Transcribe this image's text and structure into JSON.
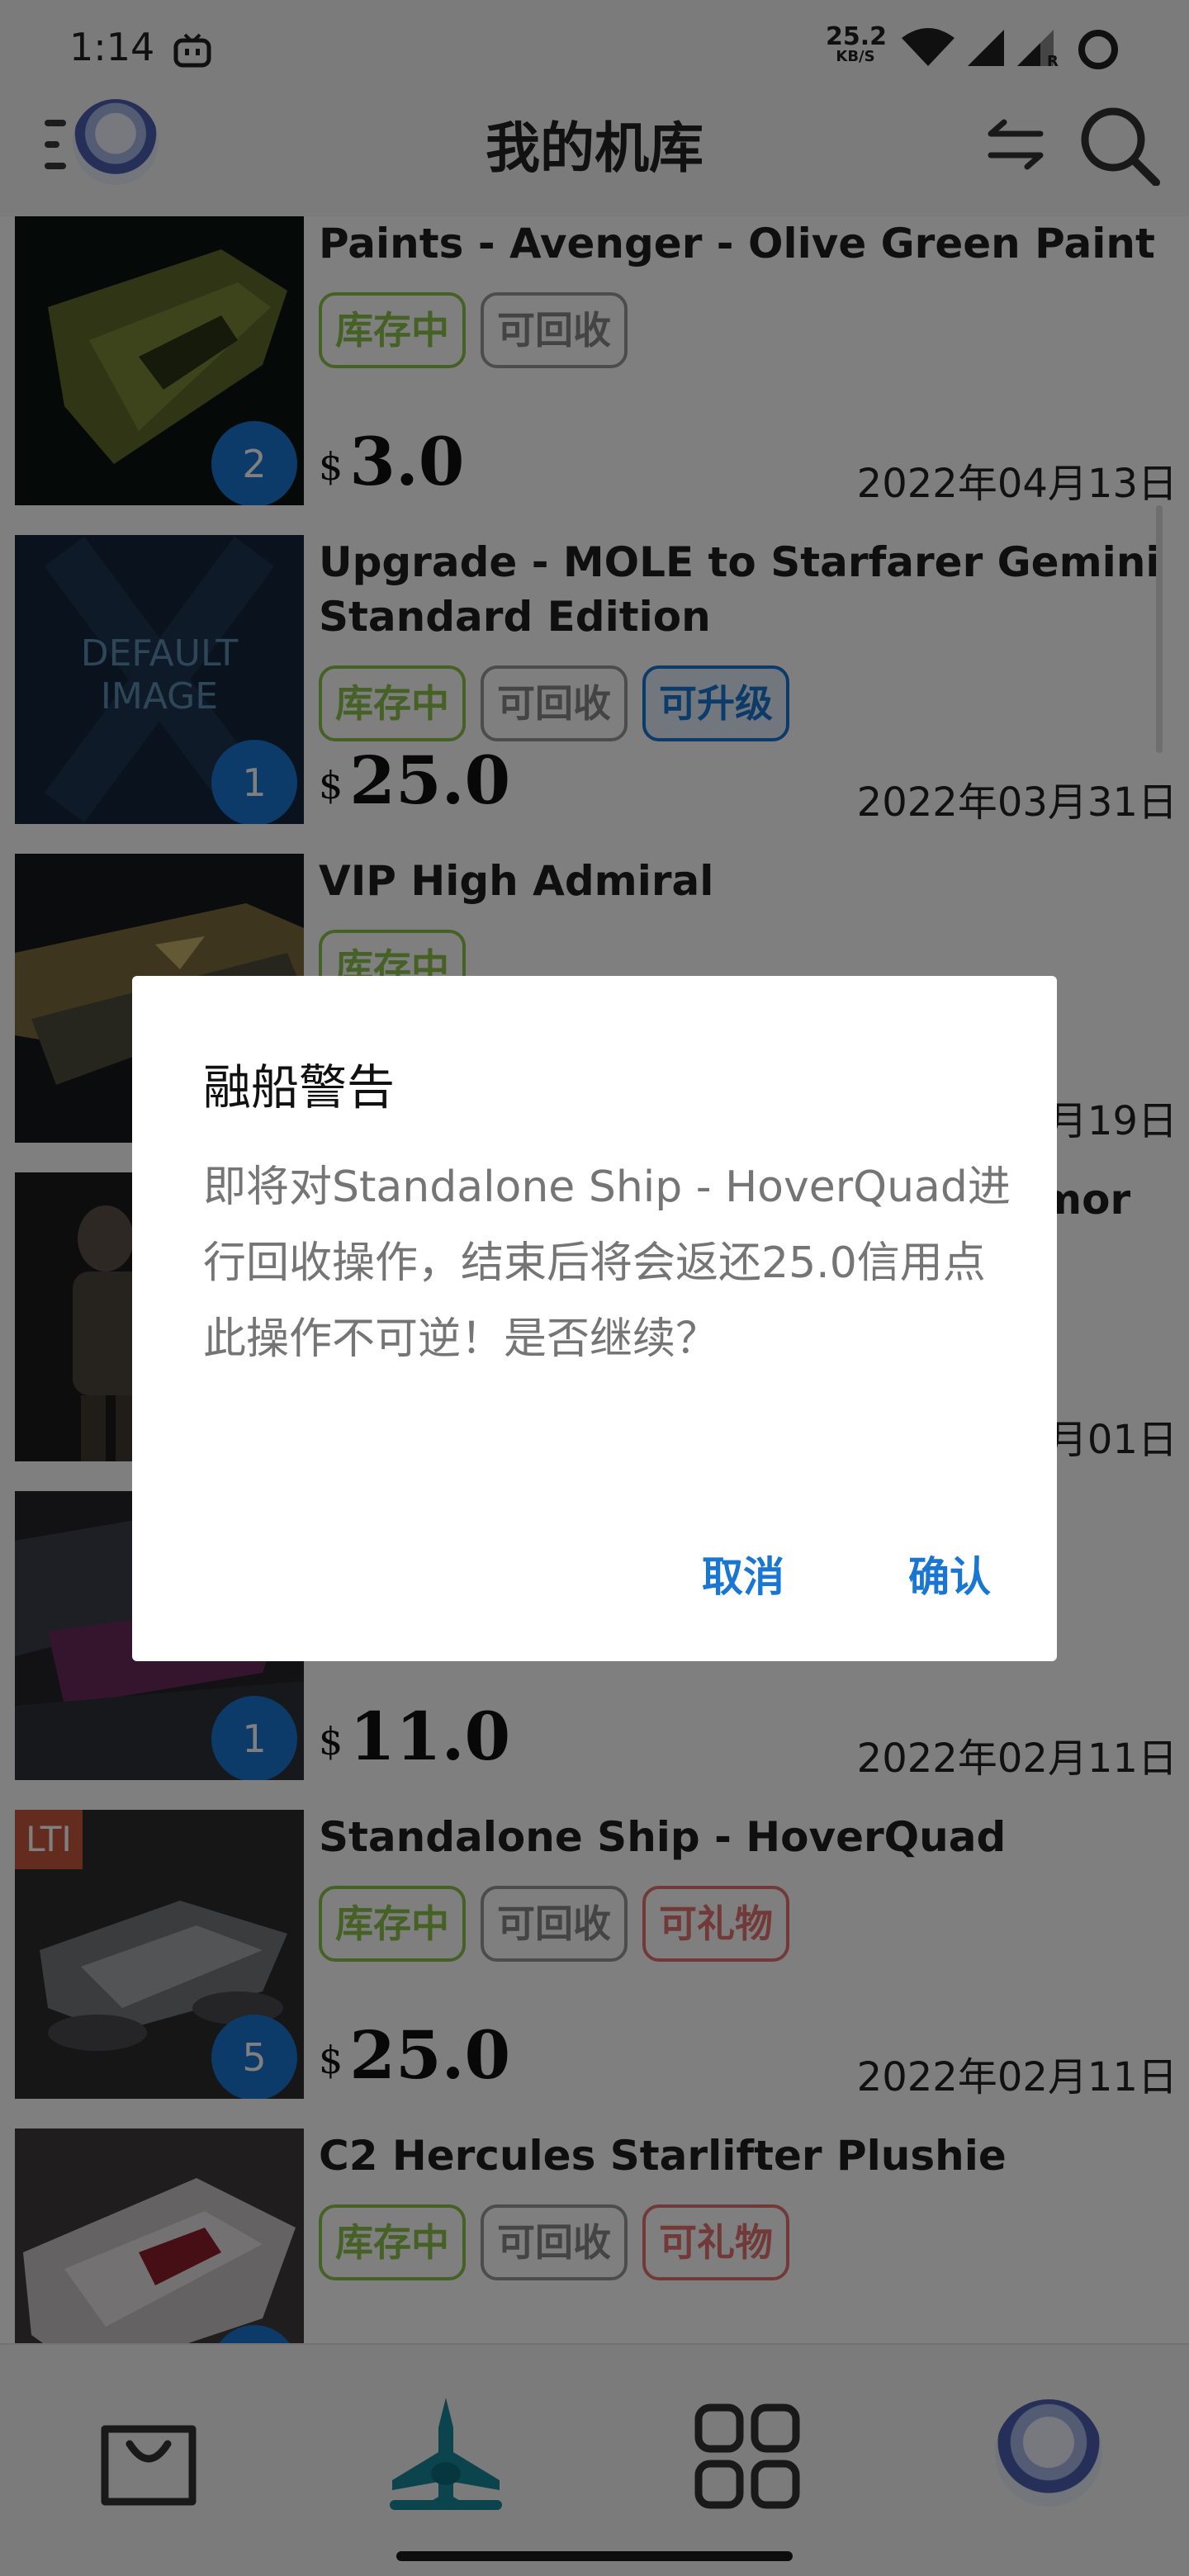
{
  "status_bar": {
    "time": "1:14",
    "net_speed_value": "25.2",
    "net_speed_unit": "KB/S",
    "roaming_label": "R"
  },
  "app_bar": {
    "title": "我的机库"
  },
  "colors": {
    "accent": "#1976d2",
    "stock_tag": "#8bc34a",
    "gift_tag": "#e57373",
    "nav_active": "#19899a",
    "lti_badge": "#c9583d"
  },
  "items": [
    {
      "title": "Paints - Avenger - Olive Green Paint",
      "tags": [
        "库存中",
        "可回收"
      ],
      "quantity": "2",
      "currency": "$",
      "price": "3.0",
      "date": "2022年04月13日"
    },
    {
      "title": "Upgrade - MOLE to Starfarer Gemini Standard Edition",
      "tags": [
        "库存中",
        "可回收",
        "可升级"
      ],
      "quantity": "1",
      "thumb_text": "DEFAULT IMAGE",
      "currency": "$",
      "price": "25.0",
      "date": "2022年03月31日"
    },
    {
      "title": "VIP High Admiral",
      "tags": [
        "库存中"
      ],
      "date": "2022年03月19日"
    },
    {
      "title": "mor",
      "date": "2022年03月01日"
    },
    {
      "quantity": "1",
      "currency": "$",
      "price": "11.0",
      "date": "2022年02月11日"
    },
    {
      "title": "Standalone Ship - HoverQuad",
      "tags": [
        "库存中",
        "可回收",
        "可礼物"
      ],
      "lti": "LTI",
      "quantity": "5",
      "currency": "$",
      "price": "25.0",
      "date": "2022年02月11日"
    },
    {
      "title": "C2 Hercules Starlifter Plushie",
      "tags": [
        "库存中",
        "可回收",
        "可礼物"
      ]
    }
  ],
  "dialog": {
    "title": "融船警告",
    "body_line1": "即将对Standalone Ship - HoverQuad进行回收操作，结束后将会返还25.0信用点",
    "body_line2": "此操作不可逆！是否继续？",
    "cancel": "取消",
    "confirm": "确认"
  },
  "bottom_nav": {
    "items": [
      "store-bag-icon",
      "hangar-ship-icon",
      "apps-grid-icon",
      "profile-avatar"
    ],
    "active": "hangar-ship-icon"
  }
}
